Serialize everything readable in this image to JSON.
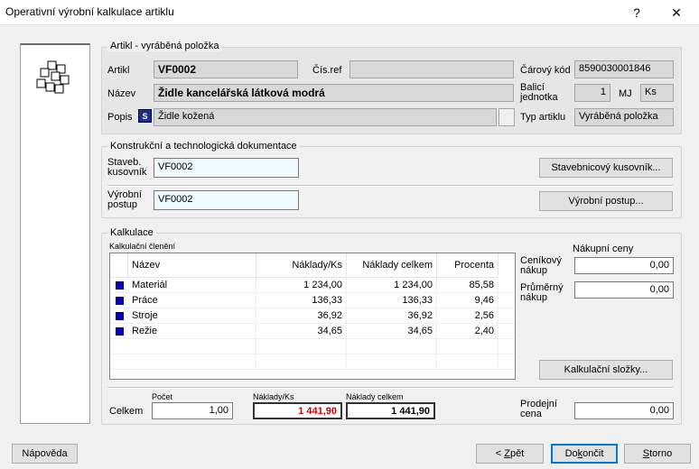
{
  "window": {
    "title": "Operativní výrobní kalkulace artiklu",
    "help_glyph": "?",
    "close_glyph": "✕"
  },
  "artikl": {
    "legend": "Artikl - vyráběná položka",
    "artikl_label": "Artikl",
    "artikl_value": "VF0002",
    "cisref_label": "Čís.ref",
    "cisref_value": "",
    "carovy_label": "Čárový kód",
    "carovy_value": "8590030001846",
    "nazev_label": "Název",
    "nazev_value": "Židle kancelářská látková modrá",
    "balici_label_1": "Balicí",
    "balici_label_2": "jednotka",
    "balici_value": "1",
    "mj_label": "MJ",
    "mj_value": "Ks",
    "popis_label": "Popis",
    "popis_badge": "S",
    "popis_value": "Židle kožená",
    "typ_label": "Typ artiklu",
    "typ_value": "Vyráběná položka"
  },
  "dokumentace": {
    "legend": "Konstrukční a technologická dokumentace",
    "staveb_label_1": "Staveb.",
    "staveb_label_2": "kusovník",
    "staveb_value": "VF0002",
    "staveb_button": "Stavebnicový kusovník...",
    "vyrobni_label_1": "Výrobní",
    "vyrobni_label_2": "postup",
    "vyrobni_value": "VF0002",
    "vyrobni_button": "Výrobní postup..."
  },
  "kalkulace": {
    "legend": "Kalkulace",
    "cleneni_label": "Kalkulační členění",
    "columns": [
      "Název",
      "Náklady/Ks",
      "Náklady celkem",
      "Procenta"
    ],
    "rows": [
      {
        "name": "Materiál",
        "naklady_ks": "1 234,00",
        "naklady_celkem": "1 234,00",
        "procenta": "85,58"
      },
      {
        "name": "Práce",
        "naklady_ks": "136,33",
        "naklady_celkem": "136,33",
        "procenta": "9,46"
      },
      {
        "name": "Stroje",
        "naklady_ks": "36,92",
        "naklady_celkem": "36,92",
        "procenta": "2,56"
      },
      {
        "name": "Režie",
        "naklady_ks": "34,65",
        "naklady_celkem": "34,65",
        "procenta": "2,40"
      }
    ],
    "nakupni_ceny_label": "Nákupní ceny",
    "cenikovy_label_1": "Ceníkový",
    "cenikovy_label_2": "nákup",
    "cenikovy_value": "0,00",
    "prumerny_label_1": "Průměrný",
    "prumerny_label_2": "nákup",
    "prumerny_value": "0,00",
    "slozky_button": "Kalkulační složky...",
    "celkem_label": "Celkem",
    "pocet_label": "Počet",
    "pocet_value": "1,00",
    "naklady_ks_label": "Náklady/Ks",
    "naklady_ks_value": "1 441,90",
    "naklady_celkem_label": "Náklady celkem",
    "naklady_celkem_value": "1 441,90",
    "prodejni_label_1": "Prodejní",
    "prodejni_label_2": "cena",
    "prodejni_value": "0,00"
  },
  "footer": {
    "napoveda": "Nápověda",
    "zpet_arrow": "<",
    "zpet_pre": " ",
    "zpet_u": "Z",
    "zpet_post": "pět",
    "dokoncit_pre": "Do",
    "dokoncit_u": "k",
    "dokoncit_post": "ončit",
    "storno_u": "S",
    "storno_post": "torno"
  },
  "colors": {
    "accent": "#0078d7",
    "red_value": "#d00000",
    "bullet_blue": "#0000c8"
  }
}
